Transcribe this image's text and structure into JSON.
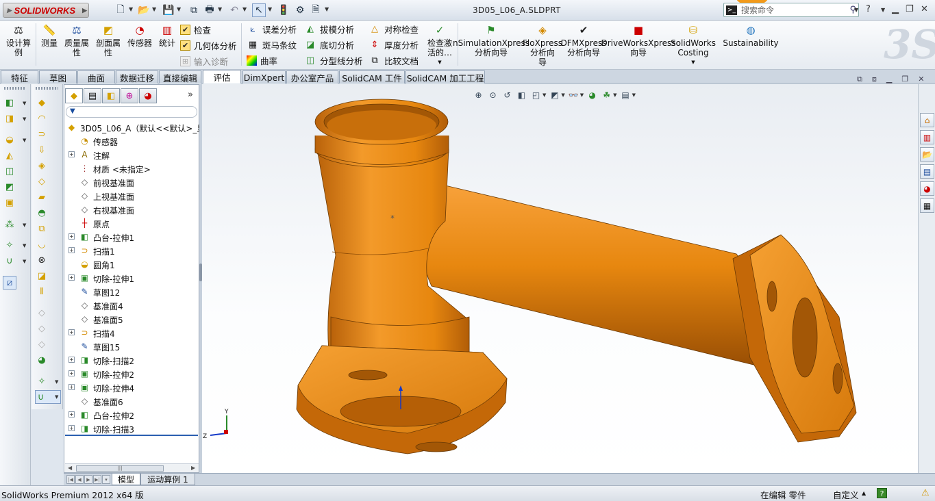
{
  "app": {
    "logo_text": "SOLIDWORKS",
    "document_title": "3D05_L06_A.SLDPRT",
    "search_placeholder": "搜索命令"
  },
  "ribbon": {
    "design_study": "设计算例",
    "measure": "测量",
    "mass_properties": "质量属性",
    "section_properties": "剖面属性",
    "sensors": "传感器",
    "statistics": "统计",
    "check": "检查",
    "geometry_analysis": "几何体分析",
    "import_diagnostics": "输入诊断",
    "deviation_analysis": "误差分析",
    "zebra_stripes": "斑马条纹",
    "curvature": "曲率",
    "draft_analysis": "拔模分析",
    "undercut_analysis": "底切分析",
    "parting_line_analysis": "分型线分析",
    "symmetry_check": "对称检查",
    "thickness_analysis": "厚度分析",
    "compare_documents": "比较文档",
    "check_active": "检查激活的…",
    "simulation_xpress_l1": "nSimulationXpress",
    "simulation_xpress_l2": "分析向导",
    "flo_xpress_l1": "FloXpress",
    "flo_xpress_l2": "分析向",
    "flo_xpress_l3": "导",
    "dfm_xpress_l1": "DFMXpress",
    "dfm_xpress_l2": "分析向导",
    "driveworks_l1": "DriveWorksXpress",
    "driveworks_l2": "向导",
    "costing_l1": "SolidWorks",
    "costing_l2": "Costing",
    "sustainability": "Sustainability"
  },
  "tabs": [
    {
      "label": "特征"
    },
    {
      "label": "草图"
    },
    {
      "label": "曲面"
    },
    {
      "label": "数据迁移"
    },
    {
      "label": "直接编辑"
    },
    {
      "label": "评估"
    },
    {
      "label": "DimXpert"
    },
    {
      "label": "办公室产品"
    },
    {
      "label": "SolidCAM 工件"
    },
    {
      "label": "SolidCAM 加工工程"
    }
  ],
  "tree": {
    "root": "3D05_L06_A（默认<<默认>_显",
    "items": [
      {
        "label": "传感器",
        "icon": "sensor-icon",
        "expand": ""
      },
      {
        "label": "注解",
        "icon": "annotation-icon",
        "expand": "+"
      },
      {
        "label": "材质 <未指定>",
        "icon": "material-icon",
        "expand": ""
      },
      {
        "label": "前视基准面",
        "icon": "plane-icon",
        "expand": ""
      },
      {
        "label": "上视基准面",
        "icon": "plane-icon",
        "expand": ""
      },
      {
        "label": "右视基准面",
        "icon": "plane-icon",
        "expand": ""
      },
      {
        "label": "原点",
        "icon": "origin-icon",
        "expand": ""
      },
      {
        "label": "凸台-拉伸1",
        "icon": "extrude-icon",
        "expand": "+"
      },
      {
        "label": "扫描1",
        "icon": "sweep-icon",
        "expand": "+"
      },
      {
        "label": "圆角1",
        "icon": "fillet-icon",
        "expand": ""
      },
      {
        "label": "切除-拉伸1",
        "icon": "cut-extrude-icon",
        "expand": "+"
      },
      {
        "label": "草图12",
        "icon": "sketch-icon",
        "expand": ""
      },
      {
        "label": "基准面4",
        "icon": "plane-icon",
        "expand": ""
      },
      {
        "label": "基准面5",
        "icon": "plane-icon",
        "expand": ""
      },
      {
        "label": "扫描4",
        "icon": "sweep-icon",
        "expand": "+"
      },
      {
        "label": "草图15",
        "icon": "sketch-icon",
        "expand": ""
      },
      {
        "label": "切除-扫描2",
        "icon": "cut-sweep-icon",
        "expand": "+"
      },
      {
        "label": "切除-拉伸2",
        "icon": "cut-extrude-icon",
        "expand": "+"
      },
      {
        "label": "切除-拉伸4",
        "icon": "cut-extrude-icon",
        "expand": "+"
      },
      {
        "label": "基准面6",
        "icon": "plane-icon",
        "expand": ""
      },
      {
        "label": "凸台-拉伸2",
        "icon": "extrude-icon",
        "expand": "+"
      },
      {
        "label": "切除-扫描3",
        "icon": "cut-sweep-icon",
        "expand": "+"
      }
    ]
  },
  "triad": {
    "x": "Z",
    "y": "Y"
  },
  "bottom_tabs": [
    {
      "label": "模型"
    },
    {
      "label": "运动算例 1"
    }
  ],
  "status": {
    "version": "SolidWorks Premium 2012 x64 版",
    "mode": "在编辑 零件",
    "custom": "自定义"
  },
  "colors": {
    "part": "#e7870f",
    "accent": "#2a5fb0"
  }
}
